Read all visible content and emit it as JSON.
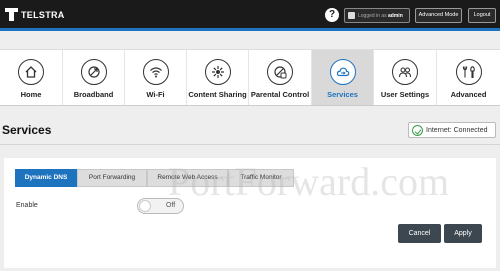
{
  "brand": {
    "name": "TELSTRA"
  },
  "header": {
    "help_label": "?",
    "logged_in_prefix": "Logged in as",
    "username": "admin",
    "advanced_mode_label": "Advanced Mode",
    "logout_label": "Logout"
  },
  "nav": {
    "items": [
      {
        "label": "Home",
        "icon": "home-icon"
      },
      {
        "label": "Broadband",
        "icon": "broadband-icon"
      },
      {
        "label": "Wi-Fi",
        "icon": "wifi-icon"
      },
      {
        "label": "Content Sharing",
        "icon": "content-sharing-icon"
      },
      {
        "label": "Parental Control",
        "icon": "parental-control-icon"
      },
      {
        "label": "Services",
        "icon": "services-icon",
        "active": true
      },
      {
        "label": "User Settings",
        "icon": "user-settings-icon"
      },
      {
        "label": "Advanced",
        "icon": "advanced-icon"
      }
    ]
  },
  "page": {
    "title": "Services",
    "internet_status": "Internet: Connected"
  },
  "tabs": [
    {
      "label": "Dynamic DNS",
      "active": true
    },
    {
      "label": "Port Forwarding"
    },
    {
      "label": "Remote Web Access"
    },
    {
      "label": "Traffic Monitor"
    }
  ],
  "form": {
    "enable_label": "Enable",
    "toggle_state": "Off"
  },
  "actions": {
    "cancel_label": "Cancel",
    "apply_label": "Apply"
  },
  "watermark": "PortForward.com",
  "colors": {
    "accent": "#1e73be",
    "topbar": "#1a1a1a",
    "button": "#3d474f",
    "status_ok": "#3a9a4a"
  }
}
